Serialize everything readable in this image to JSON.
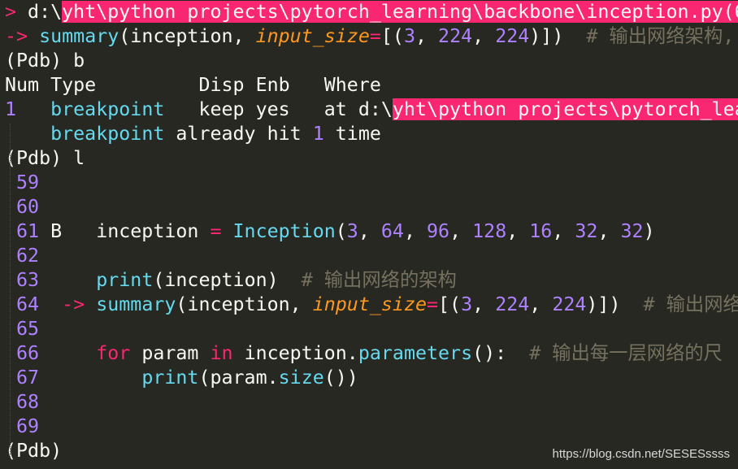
{
  "colors": {
    "background": "#272822",
    "keyword": "#f92672",
    "function": "#66d9ef",
    "number": "#ae81ff",
    "param": "#fd971f",
    "comment": "#75715e",
    "text": "#f8f8f2",
    "highlight": "#f92672"
  },
  "terminal_lines": [
    [
      [
        ">",
        "pink"
      ],
      [
        " d:\\",
        ""
      ],
      [
        "yht\\python projects\\pytorch_learning\\backbone\\inception.py(6",
        "hl"
      ]
    ],
    [
      [
        "->",
        "pink"
      ],
      [
        " ",
        ""
      ],
      [
        "summary",
        "cyan"
      ],
      [
        "(inception, ",
        ""
      ],
      [
        "input_size",
        "orange"
      ],
      [
        "=",
        "pink"
      ],
      [
        "[(",
        ""
      ],
      [
        "3",
        "purple"
      ],
      [
        ", ",
        ""
      ],
      [
        "224",
        "purple"
      ],
      [
        ", ",
        ""
      ],
      [
        "224",
        "purple"
      ],
      [
        ")])  ",
        ""
      ],
      [
        "# 输出网络架构,",
        "comment"
      ]
    ],
    [
      [
        "(Pdb) b",
        ""
      ]
    ],
    [
      [
        "Num Type         Disp Enb   Where",
        ""
      ]
    ],
    [
      [
        "1",
        "purple"
      ],
      [
        "   ",
        ""
      ],
      [
        "breakpoint",
        "cyan"
      ],
      [
        "   keep yes   at d:\\",
        ""
      ],
      [
        "yht\\python projects\\pytorch_lea",
        "hl"
      ]
    ],
    [
      [
        "    ",
        ""
      ],
      [
        "breakpoint",
        "cyan"
      ],
      [
        " already hit ",
        ""
      ],
      [
        "1",
        "purple"
      ],
      [
        " time",
        ""
      ]
    ],
    [
      [
        "(Pdb) l",
        ""
      ]
    ],
    [
      [
        " 59",
        "purple"
      ]
    ],
    [
      [
        " 60",
        "purple"
      ]
    ],
    [
      [
        " 61",
        "purple"
      ],
      [
        " B   inception ",
        ""
      ],
      [
        "=",
        "pink"
      ],
      [
        " ",
        ""
      ],
      [
        "Inception",
        "cyan"
      ],
      [
        "(",
        ""
      ],
      [
        "3",
        "purple"
      ],
      [
        ", ",
        ""
      ],
      [
        "64",
        "purple"
      ],
      [
        ", ",
        ""
      ],
      [
        "96",
        "purple"
      ],
      [
        ", ",
        ""
      ],
      [
        "128",
        "purple"
      ],
      [
        ", ",
        ""
      ],
      [
        "16",
        "purple"
      ],
      [
        ", ",
        ""
      ],
      [
        "32",
        "purple"
      ],
      [
        ", ",
        ""
      ],
      [
        "32",
        "purple"
      ],
      [
        ")",
        ""
      ]
    ],
    [
      [
        " 62",
        "purple"
      ]
    ],
    [
      [
        " 63",
        "purple"
      ],
      [
        "     ",
        ""
      ],
      [
        "print",
        "cyan"
      ],
      [
        "(inception)  ",
        ""
      ],
      [
        "# 输出网络的架构",
        "comment"
      ]
    ],
    [
      [
        " 64",
        "purple"
      ],
      [
        "  ",
        ""
      ],
      [
        "->",
        "pink"
      ],
      [
        " ",
        ""
      ],
      [
        "summary",
        "cyan"
      ],
      [
        "(inception, ",
        ""
      ],
      [
        "input_size",
        "orange"
      ],
      [
        "=",
        "pink"
      ],
      [
        "[(",
        ""
      ],
      [
        "3",
        "purple"
      ],
      [
        ", ",
        ""
      ],
      [
        "224",
        "purple"
      ],
      [
        ", ",
        ""
      ],
      [
        "224",
        "purple"
      ],
      [
        ")])  ",
        ""
      ],
      [
        "# 输出网络",
        "comment"
      ]
    ],
    [
      [
        " 65",
        "purple"
      ]
    ],
    [
      [
        " 66",
        "purple"
      ],
      [
        "     ",
        ""
      ],
      [
        "for",
        "pink"
      ],
      [
        " param ",
        ""
      ],
      [
        "in",
        "pink"
      ],
      [
        " inception.",
        ""
      ],
      [
        "parameters",
        "cyan"
      ],
      [
        "():  ",
        ""
      ],
      [
        "# 输出每一层网络的尺",
        "comment"
      ]
    ],
    [
      [
        " 67",
        "purple"
      ],
      [
        "         ",
        ""
      ],
      [
        "print",
        "cyan"
      ],
      [
        "(param.",
        ""
      ],
      [
        "size",
        "cyan"
      ],
      [
        "())",
        ""
      ]
    ],
    [
      [
        " 68",
        "purple"
      ]
    ],
    [
      [
        " 69",
        "purple"
      ]
    ],
    [
      [
        "(Pdb)",
        ""
      ]
    ]
  ],
  "watermark": "https://blog.csdn.net/SESESssss"
}
